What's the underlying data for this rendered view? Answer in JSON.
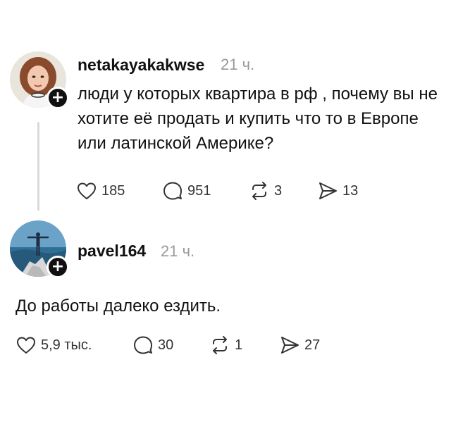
{
  "posts": [
    {
      "username": "netakayakakwse",
      "time": "21 ч.",
      "text": "люди у которых квартира в рф , почему вы не хотите её продать и купить что то в Европе или латинской Америке?",
      "badge": "+",
      "actions": {
        "likes": "185",
        "comments": "951",
        "reposts": "3",
        "shares": "13"
      }
    },
    {
      "username": "pavel164",
      "time": "21 ч.",
      "text": "До работы далеко ездить.",
      "badge": "+",
      "actions": {
        "likes": "5,9 тыс.",
        "comments": "30",
        "reposts": "1",
        "shares": "27"
      }
    }
  ],
  "icons": {
    "like": "heart-icon",
    "comment": "comment-bubble-icon",
    "repost": "repost-icon",
    "share": "send-icon",
    "follow": "plus-icon"
  },
  "colors": {
    "text": "#111111",
    "muted": "#9a9a9a",
    "icon": "#333333",
    "thread_line": "#d9d9d9",
    "badge": "#111111"
  }
}
